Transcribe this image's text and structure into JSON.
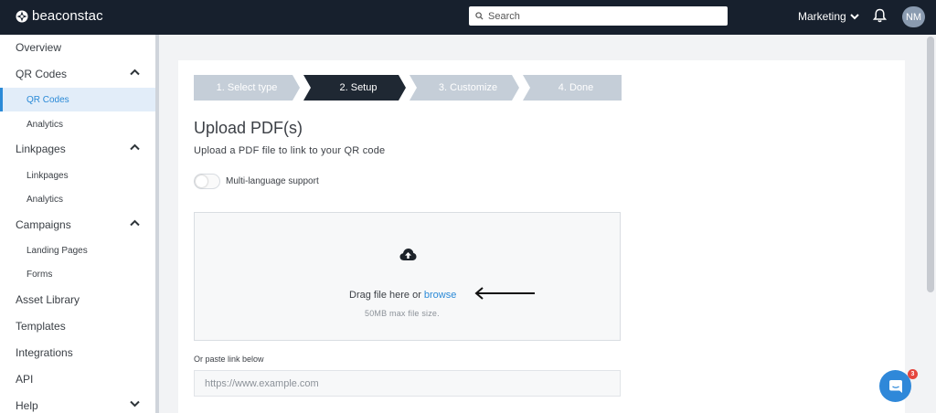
{
  "header": {
    "brand": "beaconstac",
    "search_placeholder": "Search",
    "workspace": "Marketing",
    "avatar_initials": "NM"
  },
  "sidebar": {
    "overview": "Overview",
    "qr_section": "QR Codes",
    "qr_codes": "QR Codes",
    "qr_analytics": "Analytics",
    "linkpages_section": "Linkpages",
    "linkpages": "Linkpages",
    "linkpages_analytics": "Analytics",
    "campaigns_section": "Campaigns",
    "landing_pages": "Landing Pages",
    "forms": "Forms",
    "asset_library": "Asset Library",
    "templates": "Templates",
    "integrations": "Integrations",
    "api": "API",
    "help": "Help"
  },
  "steps": [
    {
      "label": "1. Select type",
      "state": "done"
    },
    {
      "label": "2. Setup",
      "state": "active"
    },
    {
      "label": "3. Customize",
      "state": "pending"
    },
    {
      "label": "4. Done",
      "state": "pending"
    }
  ],
  "main": {
    "title": "Upload PDF(s)",
    "subtitle": "Upload a PDF file to link to your QR code",
    "toggle_label": "Multi-language support",
    "toggle_on": false,
    "drag_text": "Drag file here or",
    "browse_link": "browse",
    "size_hint": "50MB max file size.",
    "paste_label": "Or paste link below",
    "url_placeholder": "https://www.example.com"
  },
  "chat": {
    "unread": "3"
  },
  "colors": {
    "topbar": "#17202d",
    "accent": "#2b8ad7",
    "step_active": "#1f2833",
    "step_inactive": "#c5ced8"
  }
}
